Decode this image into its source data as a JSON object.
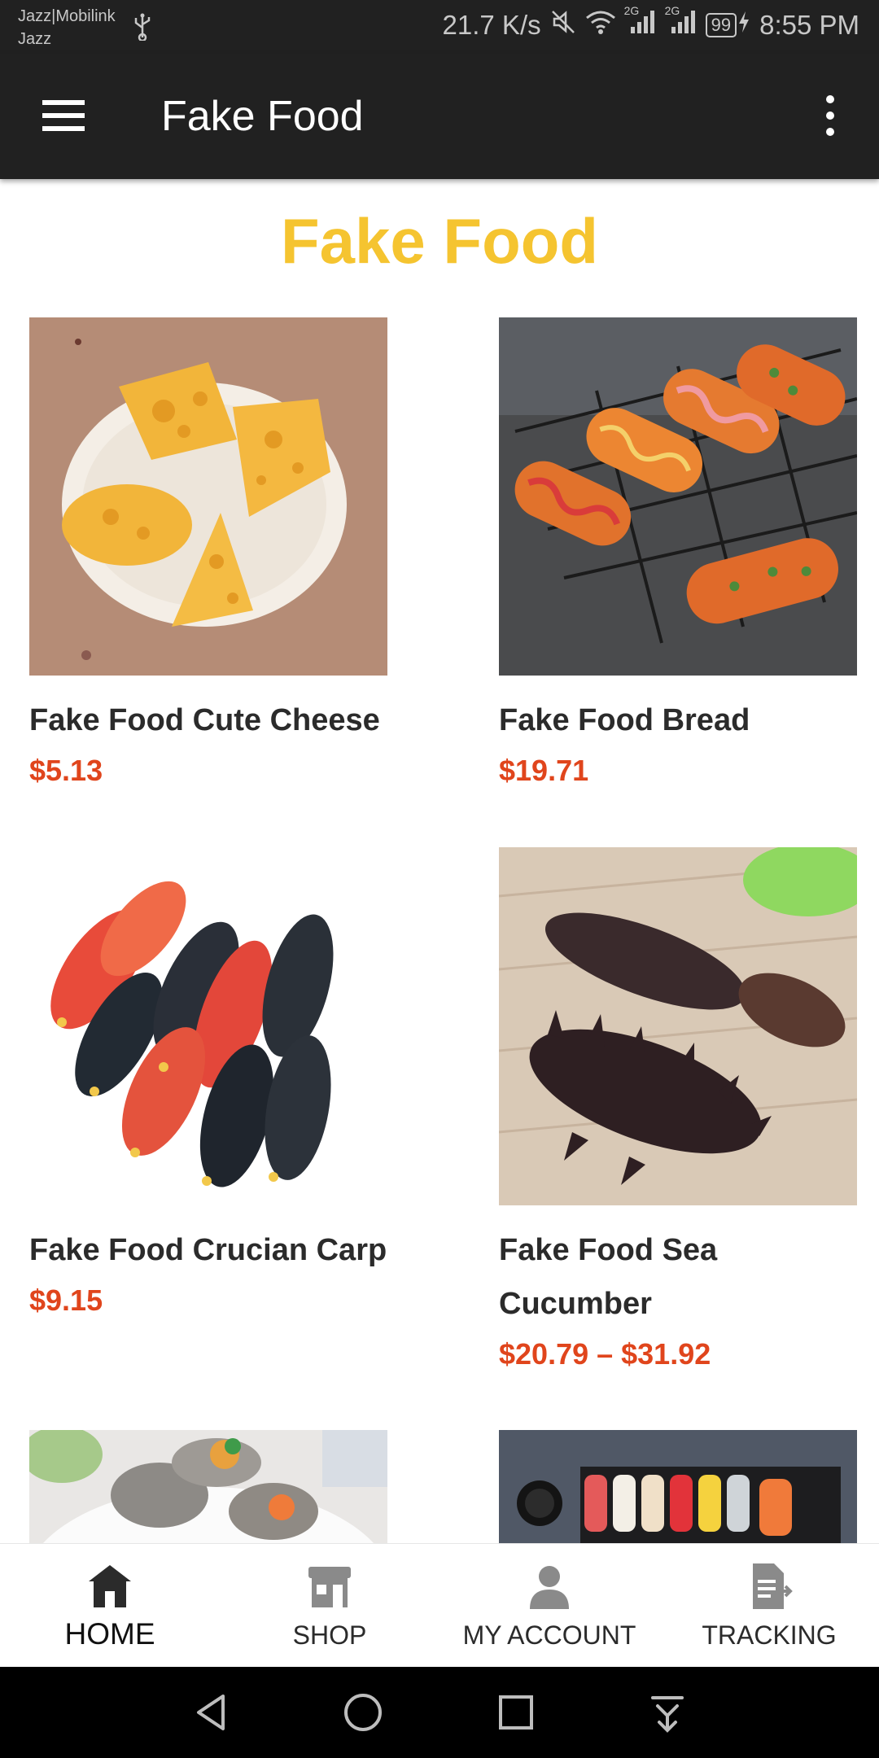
{
  "status_bar": {
    "carrier_line1": "Jazz|Mobilink",
    "carrier_line2": "Jazz",
    "network_speed": "21.7 K/s",
    "network_2g_a": "2G",
    "network_2g_b": "2G",
    "battery": "99",
    "time": "8:55 PM"
  },
  "app_bar": {
    "title": "Fake Food",
    "menu_icon": "hamburger-menu-icon",
    "more_icon": "more-vertical-icon"
  },
  "page": {
    "heading": "Fake Food"
  },
  "products": [
    {
      "name": "Fake Food Cute Cheese",
      "price": "$5.13"
    },
    {
      "name": "Fake Food Bread",
      "price": "$19.71"
    },
    {
      "name": "Fake Food Crucian Carp",
      "price": "$9.15"
    },
    {
      "name": "Fake Food Sea Cucumber",
      "price": "$20.79 – $31.92"
    }
  ],
  "bottom_nav": [
    {
      "label": "HOME",
      "icon": "home-icon",
      "active": true
    },
    {
      "label": "SHOP",
      "icon": "shop-icon",
      "active": false
    },
    {
      "label": "MY ACCOUNT",
      "icon": "account-icon",
      "active": false
    },
    {
      "label": "TRACKING",
      "icon": "tracking-icon",
      "active": false
    }
  ],
  "system_nav": {
    "back_icon": "back-triangle-icon",
    "home_icon": "home-circle-icon",
    "recents_icon": "recents-square-icon",
    "notifications_icon": "pull-down-icon"
  },
  "colors": {
    "app_bar": "#212121",
    "heading": "#f5c430",
    "price": "#e0451c",
    "text": "#2b2b2b"
  }
}
